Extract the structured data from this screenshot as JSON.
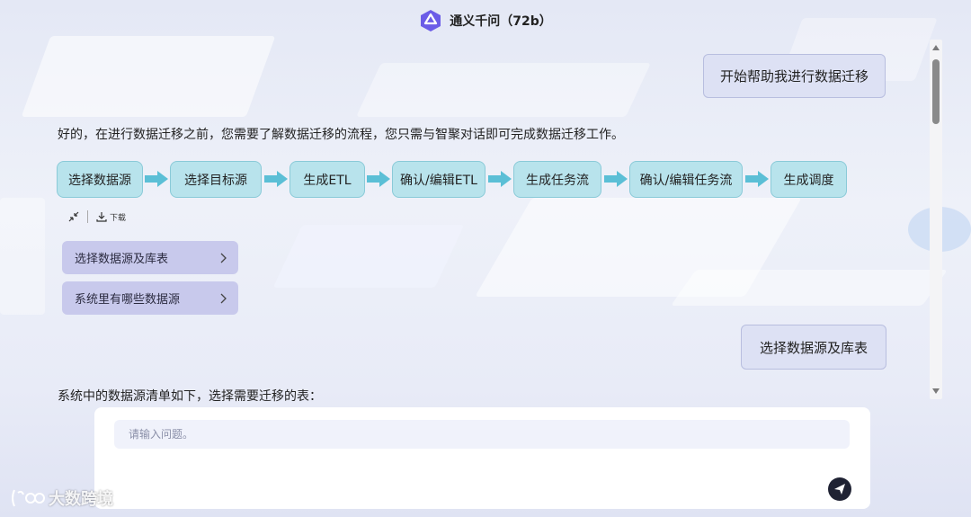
{
  "header": {
    "title": "通义千问（72b）"
  },
  "messages": {
    "user_1": "开始帮助我进行数据迁移",
    "reply_1": "好的，在进行数据迁移之前，您需要了解数据迁移的流程，您只需与智聚对话即可完成数据迁移工作。",
    "user_2": "选择数据源及库表",
    "reply_2": "系统中的数据源清单如下，选择需要迁移的表："
  },
  "flow": {
    "steps": [
      "选择数据源",
      "选择目标源",
      "生成ETL",
      "确认/编辑ETL",
      "生成任务流",
      "确认/编辑任务流",
      "生成调度"
    ]
  },
  "tools": {
    "download_label": "下载"
  },
  "suggestions": [
    "选择数据源及库表",
    "系统里有哪些数据源"
  ],
  "input": {
    "placeholder": "请输入问题。",
    "value": ""
  },
  "watermark": {
    "text": "大数跨境"
  },
  "colors": {
    "step_fill": "#b8e3ec",
    "arrow": "#5bbfd6",
    "suggestion_fill": "#c8c9ec",
    "user_bubble": "#dde1f4"
  }
}
